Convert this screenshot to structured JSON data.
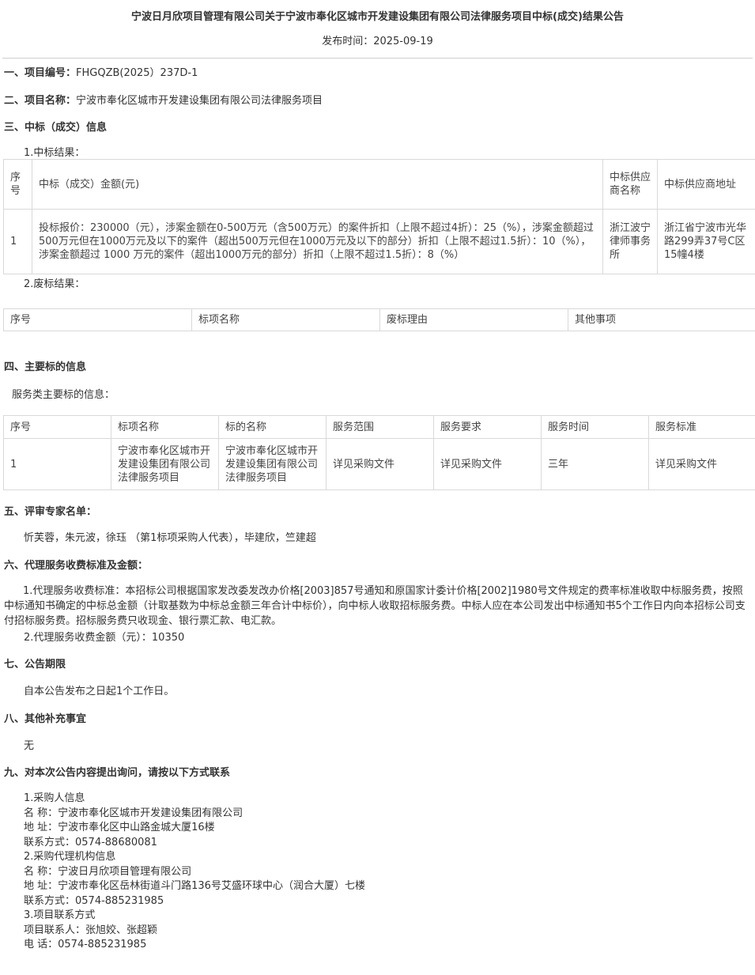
{
  "header": {
    "title": "宁波日月欣项目管理有限公司关于宁波市奉化区城市开发建设集团有限公司法律服务项目中标(成交)结果公告",
    "publish_date": "发布时间：2025-09-19"
  },
  "s1": {
    "heading": "一、项目编号：",
    "value": "FHGQZB(2025）237D-1"
  },
  "s2": {
    "heading": "二、项目名称：",
    "value": "宁波市奉化区城市开发建设集团有限公司法律服务项目"
  },
  "s3": {
    "heading": "三、中标（成交）信息",
    "sub1": "1.中标结果：",
    "win_table": {
      "headers": [
        "序号",
        "中标（成交）金额(元)",
        "中标供应商名称",
        "中标供应商地址"
      ],
      "row": [
        "1",
        "投标报价：230000（元），涉案金额在0-500万元（含500万元）的案件折扣（上限不超过4折）：25（%），涉案金额超过500万元但在1000万元及以下的案件（超出500万元但在1000万元及以下的部分）折扣（上限不超过1.5折）：10（%），涉案金额超过 1000 万元的案件（超出1000万元的部分）折扣（上限不超过1.5折）：8（%）",
        "浙江波宁律师事务所",
        "浙江省宁波市光华路299弄37号C区15幢4楼"
      ]
    },
    "sub2": "2.废标结果：",
    "fail_table": {
      "headers": [
        "序号",
        "标项名称",
        "废标理由",
        "其他事项"
      ]
    }
  },
  "s4": {
    "heading": "四、主要标的信息",
    "sub": "服务类主要标的信息：",
    "table": {
      "headers": [
        "序号",
        "标项名称",
        "标的名称",
        "服务范围",
        "服务要求",
        "服务时间",
        "服务标准"
      ],
      "row": [
        "1",
        "宁波市奉化区城市开发建设集团有限公司法律服务项目",
        "宁波市奉化区城市开发建设集团有限公司法律服务项目",
        "详见采购文件",
        "详见采购文件",
        "三年",
        "详见采购文件"
      ]
    }
  },
  "s5": {
    "heading": "五、评审专家名单：",
    "text": "忻芙蓉，朱元波，徐珏 （第1标项采购人代表），毕建欣，竺建超"
  },
  "s6": {
    "heading": "六、代理服务收费标准及金额：",
    "p1": "1.代理服务收费标准：本招标公司根据国家发改委发改办价格[2003]857号通知和原国家计委计价格[2002]1980号文件规定的费率标准收取中标服务费，按照中标通知书确定的中标总金额（计取基数为中标总金额三年合计中标价），向中标人收取招标服务费。中标人应在本公司发出中标通知书5个工作日内向本招标公司支付招标服务费。招标服务费只收现金、银行票汇款、电汇款。",
    "p2": "2.代理服务收费金额（元）：10350"
  },
  "s7": {
    "heading": "七、公告期限",
    "text": "自本公告发布之日起1个工作日。"
  },
  "s8": {
    "heading": "八、其他补充事宜",
    "text": "无"
  },
  "s9": {
    "heading": "九、对本次公告内容提出询问，请按以下方式联系",
    "lines": [
      "1.采购人信息",
      "名 称：宁波市奉化区城市开发建设集团有限公司",
      "地 址：宁波市奉化区中山路金城大厦16楼",
      "联系方式：0574-88680081",
      "2.采购代理机构信息",
      "名 称：宁波日月欣项目管理有限公司",
      "地 址：宁波市奉化区岳林街道斗门路136号艾盛环球中心（润合大厦）七楼",
      "联系方式：0574-885231985",
      "3.项目联系方式",
      "项目联系人：张旭姣、张超颖",
      "电 话：0574-885231985"
    ]
  }
}
